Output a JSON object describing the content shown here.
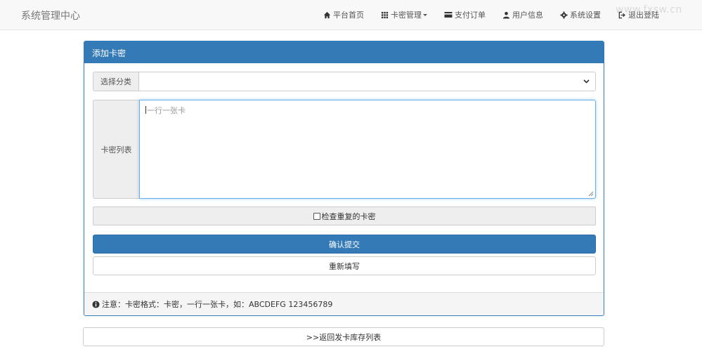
{
  "brand": "系统管理中心",
  "nav": [
    {
      "label": "平台首页",
      "icon": "home-icon"
    },
    {
      "label": "卡密管理",
      "icon": "grid-icon",
      "dropdown": true
    },
    {
      "label": "支付订单",
      "icon": "credit-card-icon"
    },
    {
      "label": "用户信息",
      "icon": "user-icon"
    },
    {
      "label": "系统设置",
      "icon": "gear-icon"
    },
    {
      "label": "退出登陆",
      "icon": "logout-icon"
    }
  ],
  "watermark": "www.fxsw.cn",
  "panel": {
    "title": "添加卡密",
    "category_label": "选择分类",
    "category_value": "",
    "list_label": "卡密列表",
    "list_placeholder": "一行一张卡",
    "check_label": "检查重复的卡密",
    "check_checked": false,
    "submit_label": "确认提交",
    "reset_label": "重新填写",
    "footer_note": "注意：卡密格式：卡密，一行一张卡，如：ABCDEFG 123456789"
  },
  "back_label": ">>返回发卡库存列表",
  "colors": {
    "primary": "#337ab7",
    "navbar_bg": "#f8f8f8",
    "addon_bg": "#eeeeee"
  }
}
